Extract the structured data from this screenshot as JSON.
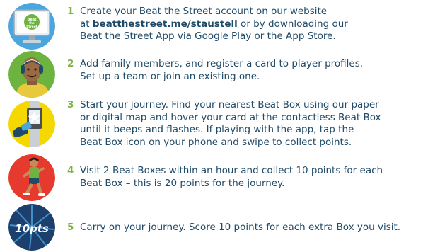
{
  "steps": [
    {
      "number": "1",
      "icon": "computer-monitor-icon",
      "line1": "Create your Beat the Street account on our website",
      "line2_prefix": "at ",
      "link": "beatthestreet.me/staustell",
      "line2_suffix": " or by downloading our",
      "line3": "Beat the Street App via Google Play or the App Store.",
      "logo_text": "Beat the Street"
    },
    {
      "number": "2",
      "icon": "family-member-icon",
      "line1": "Add family members, and register a card to player profiles.",
      "line2": "Set up a team or join an existing one."
    },
    {
      "number": "3",
      "icon": "beat-box-icon",
      "line1": "Start your journey. Find your nearest Beat Box using our paper",
      "line2": "or digital map and hover your card at the contactless Beat Box",
      "line3": "until it beeps and flashes. If playing with the app, tap the",
      "line4": "Beat Box icon on your phone and swipe to collect points."
    },
    {
      "number": "4",
      "icon": "runner-icon",
      "line1": "Visit 2 Beat Boxes within an hour and collect 10 points for each",
      "line2": "Beat Box – this is 20 points for the journey."
    },
    {
      "number": "5",
      "icon": "ten-points-badge-icon",
      "line1": "Carry on your journey. Score 10 points for each extra Box you visit.",
      "badge_text": "10pts"
    }
  ],
  "colors": {
    "text": "#1f4a68",
    "number": "#7cb342",
    "step1_bg": "#4aa6dc",
    "step2_bg": "#6db33f",
    "step3_bg": "#f5d800",
    "step4_bg": "#e63a2e",
    "step5_bg": "#1d3f6e"
  }
}
